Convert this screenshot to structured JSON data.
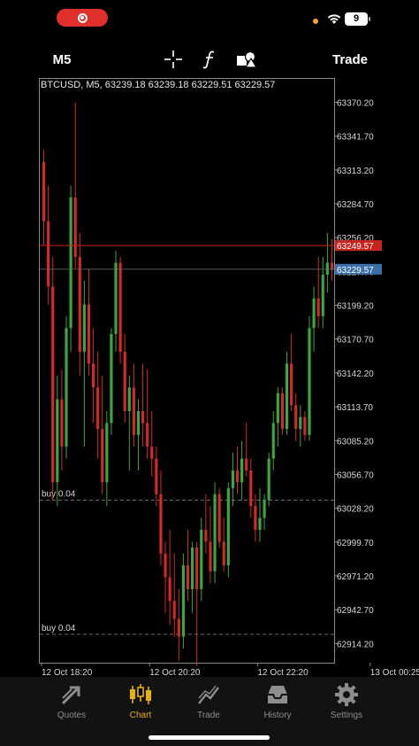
{
  "status_bar": {
    "battery_level": "9",
    "recording_icon": "screen-record-icon",
    "wifi_icon": "wifi-icon"
  },
  "toolbar": {
    "timeframe": "M5",
    "crosshair_icon": "crosshair-icon",
    "indicators_icon": "function-icon",
    "objects_icon": "shapes-icon",
    "trade_label": "Trade"
  },
  "chart": {
    "title": "BTCUSD, M5, 63239.18 63239.18 63229.51 63229.57",
    "colors": {
      "bull": "#3aa83a",
      "bear": "#d42a24",
      "ask_line": "#c8231d",
      "bid_line": "#3b6fa8",
      "grid": "#4a4a4a"
    },
    "ask_price": "63249.57",
    "bid_price": "63229.57",
    "orders": [
      {
        "label": "buy 0.04",
        "price": 63035.0
      },
      {
        "label": "buy 0.04",
        "price": 62922.0
      }
    ]
  },
  "chart_data": {
    "type": "candlestick",
    "symbol": "BTCUSD",
    "timeframe": "M5",
    "ylim": [
      62898,
      63390
    ],
    "y_ticks": [
      "63370.20",
      "63341.70",
      "63313.20",
      "63284.70",
      "63256.20",
      "63227.70",
      "63199.20",
      "63170.70",
      "63142.20",
      "63113.70",
      "63085.20",
      "63056.70",
      "63028.20",
      "62999.70",
      "62971.20",
      "62942.70",
      "62914.20"
    ],
    "x_ticks": [
      {
        "label": "12 Oct 18:20",
        "index": 0
      },
      {
        "label": "12 Oct 20:20",
        "index": 24
      },
      {
        "label": "12 Oct 22:20",
        "index": 48
      },
      {
        "label": "13 Oct 00:25",
        "index": 73
      }
    ],
    "candles": [
      {
        "o": 63320,
        "h": 63330,
        "l": 63250,
        "c": 63270
      },
      {
        "o": 63270,
        "h": 63300,
        "l": 63200,
        "c": 63215
      },
      {
        "o": 63215,
        "h": 63240,
        "l": 63035,
        "c": 63050
      },
      {
        "o": 63050,
        "h": 63140,
        "l": 63030,
        "c": 63120
      },
      {
        "o": 63120,
        "h": 63145,
        "l": 63060,
        "c": 63080
      },
      {
        "o": 63080,
        "h": 63190,
        "l": 63070,
        "c": 63180
      },
      {
        "o": 63180,
        "h": 63300,
        "l": 63160,
        "c": 63290
      },
      {
        "o": 63290,
        "h": 63370,
        "l": 63230,
        "c": 63240
      },
      {
        "o": 63240,
        "h": 63260,
        "l": 63140,
        "c": 63160
      },
      {
        "o": 63160,
        "h": 63220,
        "l": 63080,
        "c": 63200
      },
      {
        "o": 63200,
        "h": 63230,
        "l": 63140,
        "c": 63150
      },
      {
        "o": 63150,
        "h": 63180,
        "l": 63100,
        "c": 63130
      },
      {
        "o": 63130,
        "h": 63160,
        "l": 63070,
        "c": 63095
      },
      {
        "o": 63095,
        "h": 63140,
        "l": 63040,
        "c": 63050
      },
      {
        "o": 63050,
        "h": 63110,
        "l": 63030,
        "c": 63100
      },
      {
        "o": 63100,
        "h": 63180,
        "l": 63090,
        "c": 63175
      },
      {
        "o": 63175,
        "h": 63245,
        "l": 63160,
        "c": 63235
      },
      {
        "o": 63235,
        "h": 63240,
        "l": 63150,
        "c": 63160
      },
      {
        "o": 63160,
        "h": 63175,
        "l": 63100,
        "c": 63110
      },
      {
        "o": 63110,
        "h": 63140,
        "l": 63060,
        "c": 63130
      },
      {
        "o": 63130,
        "h": 63150,
        "l": 63080,
        "c": 63090
      },
      {
        "o": 63090,
        "h": 63120,
        "l": 63060,
        "c": 63110
      },
      {
        "o": 63110,
        "h": 63150,
        "l": 63080,
        "c": 63100
      },
      {
        "o": 63100,
        "h": 63145,
        "l": 63070,
        "c": 63080
      },
      {
        "o": 63080,
        "h": 63110,
        "l": 63055,
        "c": 63070
      },
      {
        "o": 63070,
        "h": 63080,
        "l": 63030,
        "c": 63040
      },
      {
        "o": 63040,
        "h": 63060,
        "l": 62980,
        "c": 62990
      },
      {
        "o": 62990,
        "h": 63000,
        "l": 62940,
        "c": 62970
      },
      {
        "o": 62970,
        "h": 63010,
        "l": 62930,
        "c": 62950
      },
      {
        "o": 62950,
        "h": 62990,
        "l": 62920,
        "c": 62935
      },
      {
        "o": 62935,
        "h": 62960,
        "l": 62900,
        "c": 62920
      },
      {
        "o": 62920,
        "h": 62990,
        "l": 62910,
        "c": 62980
      },
      {
        "o": 62980,
        "h": 63010,
        "l": 62950,
        "c": 62960
      },
      {
        "o": 62960,
        "h": 63000,
        "l": 62940,
        "c": 62995
      },
      {
        "o": 62995,
        "h": 63000,
        "l": 62895,
        "c": 62960
      },
      {
        "o": 62960,
        "h": 63020,
        "l": 62950,
        "c": 63010
      },
      {
        "o": 63010,
        "h": 63040,
        "l": 62990,
        "c": 63000
      },
      {
        "o": 63000,
        "h": 63030,
        "l": 62965,
        "c": 62975
      },
      {
        "o": 62975,
        "h": 63050,
        "l": 62965,
        "c": 63040
      },
      {
        "o": 63040,
        "h": 63045,
        "l": 62995,
        "c": 63000
      },
      {
        "o": 63000,
        "h": 63020,
        "l": 62975,
        "c": 62980
      },
      {
        "o": 62980,
        "h": 63050,
        "l": 62970,
        "c": 63045
      },
      {
        "o": 63045,
        "h": 63075,
        "l": 63030,
        "c": 63060
      },
      {
        "o": 63060,
        "h": 63080,
        "l": 63040,
        "c": 63050
      },
      {
        "o": 63050,
        "h": 63085,
        "l": 63035,
        "c": 63070
      },
      {
        "o": 63070,
        "h": 63100,
        "l": 63055,
        "c": 63060
      },
      {
        "o": 63060,
        "h": 63070,
        "l": 63020,
        "c": 63030
      },
      {
        "o": 63030,
        "h": 63040,
        "l": 63000,
        "c": 63010
      },
      {
        "o": 63010,
        "h": 63045,
        "l": 63000,
        "c": 63020
      },
      {
        "o": 63020,
        "h": 63040,
        "l": 63010,
        "c": 63035
      },
      {
        "o": 63035,
        "h": 63075,
        "l": 63030,
        "c": 63070
      },
      {
        "o": 63070,
        "h": 63110,
        "l": 63060,
        "c": 63100
      },
      {
        "o": 63100,
        "h": 63130,
        "l": 63080,
        "c": 63125
      },
      {
        "o": 63125,
        "h": 63130,
        "l": 63090,
        "c": 63095
      },
      {
        "o": 63095,
        "h": 63160,
        "l": 63090,
        "c": 63150
      },
      {
        "o": 63150,
        "h": 63175,
        "l": 63110,
        "c": 63115
      },
      {
        "o": 63115,
        "h": 63125,
        "l": 63085,
        "c": 63095
      },
      {
        "o": 63095,
        "h": 63115,
        "l": 63080,
        "c": 63105
      },
      {
        "o": 63105,
        "h": 63110,
        "l": 63085,
        "c": 63090
      },
      {
        "o": 63090,
        "h": 63190,
        "l": 63085,
        "c": 63180
      },
      {
        "o": 63180,
        "h": 63215,
        "l": 63160,
        "c": 63205
      },
      {
        "o": 63205,
        "h": 63240,
        "l": 63180,
        "c": 63190
      },
      {
        "o": 63190,
        "h": 63240,
        "l": 63180,
        "c": 63225
      },
      {
        "o": 63225,
        "h": 63260,
        "l": 63210,
        "c": 63235
      },
      {
        "o": 63235,
        "h": 63255,
        "l": 63220,
        "c": 63229
      }
    ]
  },
  "tabs": [
    {
      "label": "Quotes",
      "icon": "quotes-arrow-icon"
    },
    {
      "label": "Chart",
      "icon": "candlestick-chart-icon",
      "active": true
    },
    {
      "label": "Trade",
      "icon": "trade-trend-icon"
    },
    {
      "label": "History",
      "icon": "history-inbox-icon"
    },
    {
      "label": "Settings",
      "icon": "gear-icon"
    }
  ]
}
